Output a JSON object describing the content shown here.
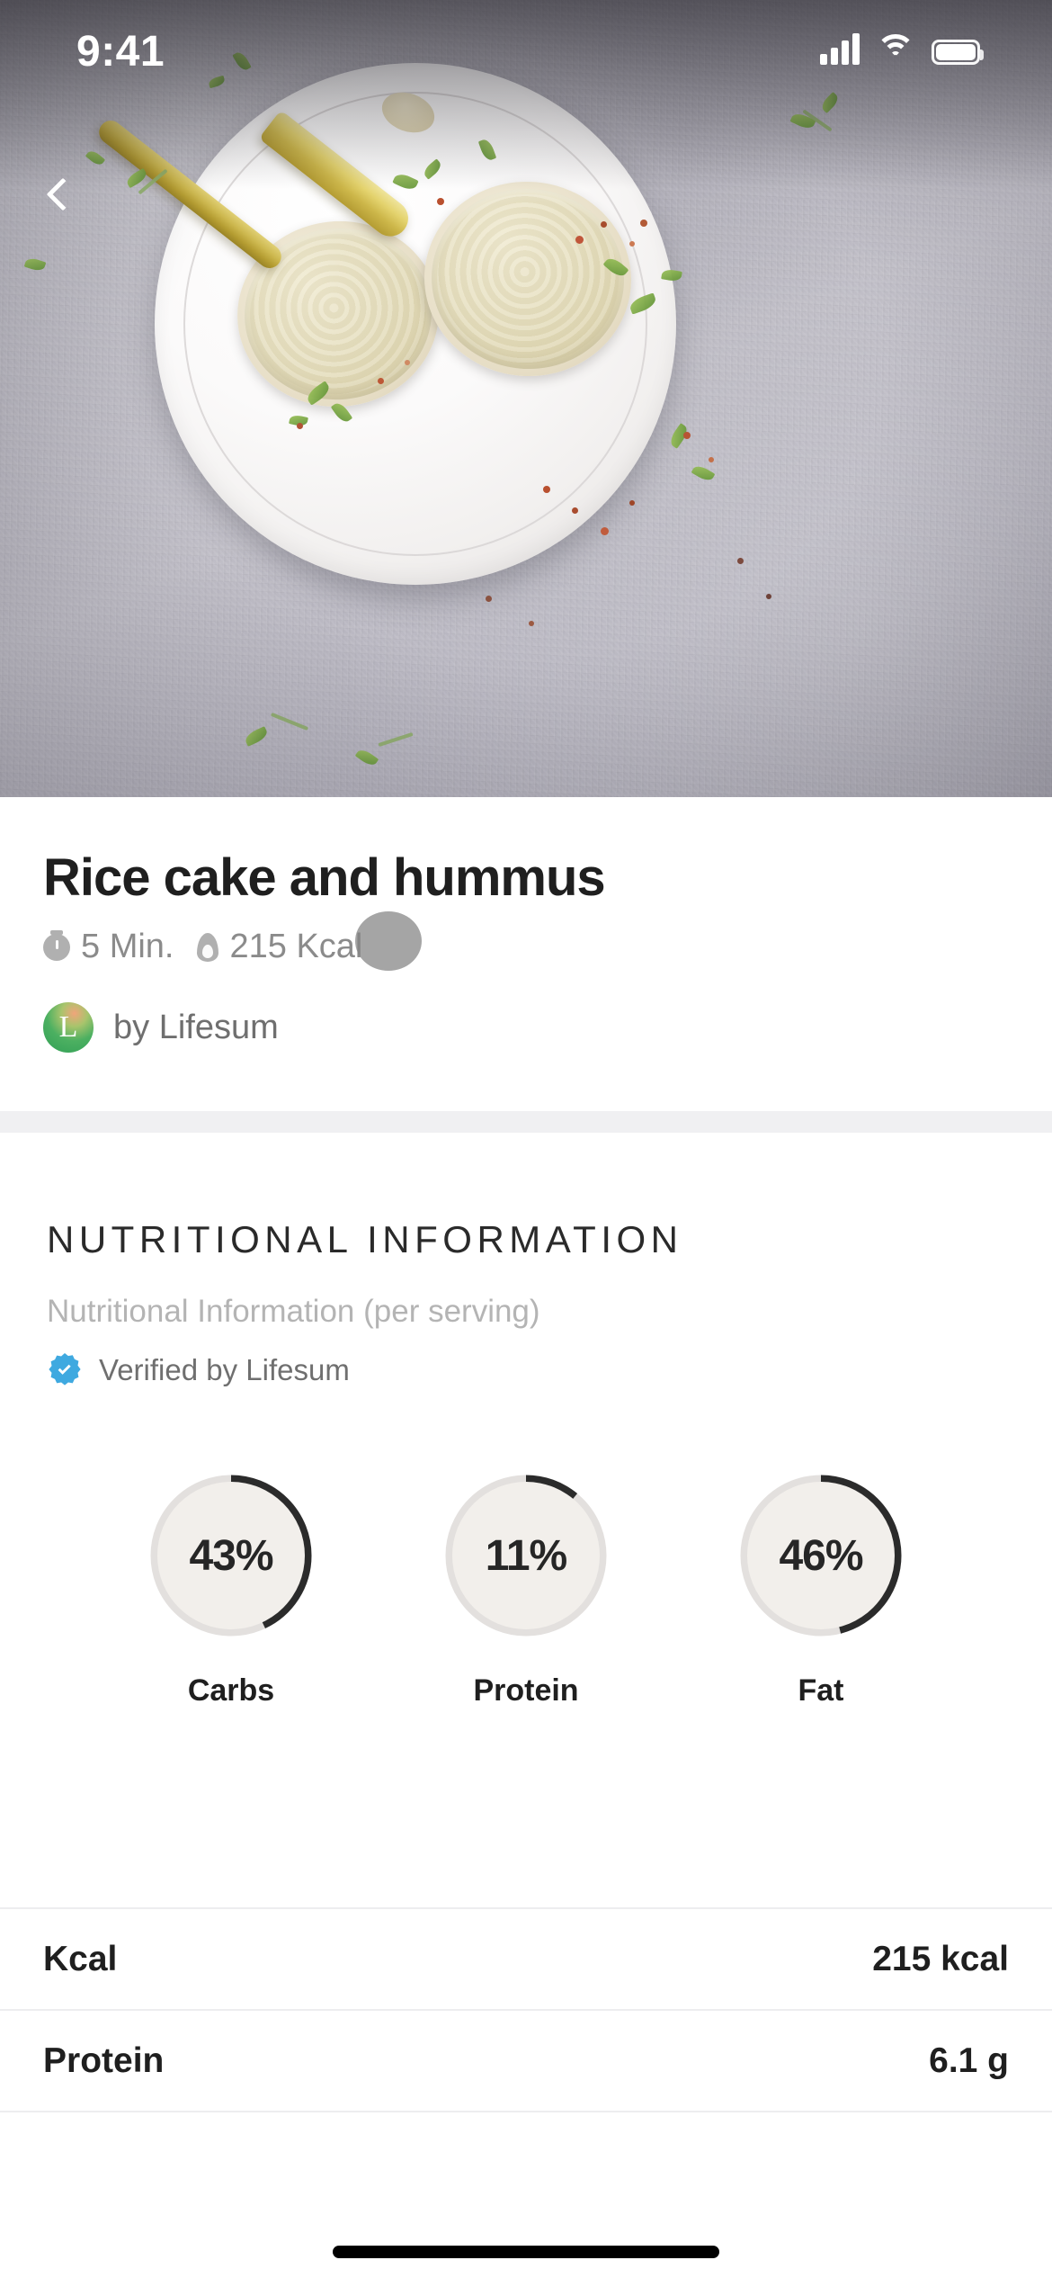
{
  "status_bar": {
    "time": "9:41",
    "icons": [
      "cellular-signal-icon",
      "wifi-icon",
      "battery-icon"
    ]
  },
  "hero": {
    "back_icon": "chevron-left-icon",
    "photo_alt": "rice cakes topped with hummus on a white plate with a gold knife"
  },
  "recipe": {
    "title": "Rice cake and hummus",
    "time_icon": "timer-icon",
    "time": "5 Min.",
    "calorie_icon": "flame-icon",
    "calories": "215 Kcal",
    "author_logo_letter": "L",
    "author": "by Lifesum"
  },
  "nutrition": {
    "heading": "NUTRITIONAL INFORMATION",
    "subheading": "Nutritional Information (per serving)",
    "verified_icon": "verified-badge-icon",
    "verified_label": "Verified by Lifesum",
    "verified_color": "#3fa9e0",
    "macros": [
      {
        "label": "Carbs",
        "value": "43%",
        "pct": 43
      },
      {
        "label": "Protein",
        "value": "11%",
        "pct": 11
      },
      {
        "label": "Fat",
        "value": "46%",
        "pct": 46
      }
    ],
    "ring_track_color": "#e3e0de",
    "ring_fill_color": "#2b2b2b",
    "ring_face_color": "#f2efeb",
    "rows": [
      {
        "key": "Kcal",
        "value": "215 kcal"
      },
      {
        "key": "Protein",
        "value": "6.1 g"
      }
    ]
  },
  "chart_data": {
    "type": "pie",
    "title": "Macronutrient distribution (per serving)",
    "categories": [
      "Carbs",
      "Protein",
      "Fat"
    ],
    "values": [
      43,
      11,
      46
    ],
    "unit": "%",
    "labels": [
      "43%",
      "11%",
      "46%"
    ],
    "rendered_as": "three separate donut gauges, each arc starting at 12 o'clock clockwise",
    "track_color": "#e3e0de",
    "arc_color": "#2b2b2b",
    "legend": [
      "Carbs",
      "Protein",
      "Fat"
    ],
    "legend_position": "below each gauge"
  }
}
